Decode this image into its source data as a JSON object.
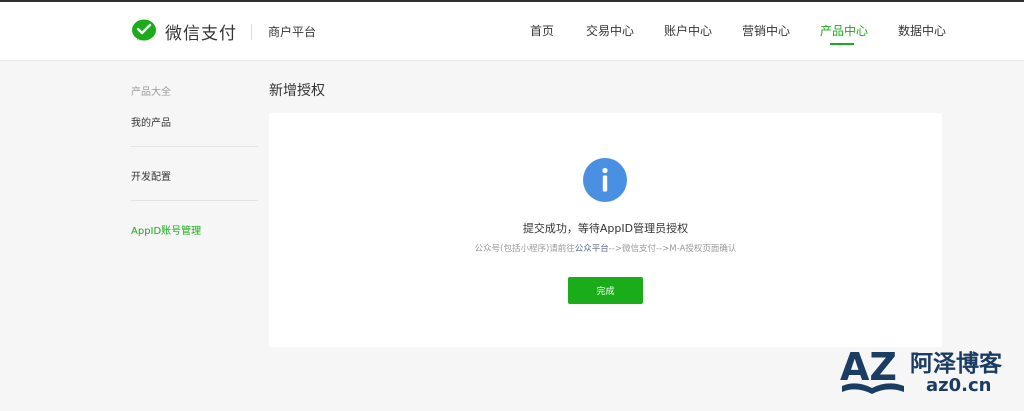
{
  "header": {
    "brand_name": "微信支付",
    "brand_sub": "商户平台",
    "nav": [
      {
        "label": "首页",
        "active": false
      },
      {
        "label": "交易中心",
        "active": false
      },
      {
        "label": "账户中心",
        "active": false
      },
      {
        "label": "营销中心",
        "active": false
      },
      {
        "label": "产品中心",
        "active": true
      },
      {
        "label": "数据中心",
        "active": false
      }
    ]
  },
  "sidebar": {
    "group_title": "产品大全",
    "items": [
      {
        "label": "我的产品",
        "active": false
      },
      {
        "label": "开发配置",
        "active": false
      },
      {
        "label": "AppID账号管理",
        "active": true
      }
    ]
  },
  "main": {
    "page_title": "新增授权",
    "message_title": "提交成功，等待AppID管理员授权",
    "message_desc_prefix": "公众号(包括小程序)请前往",
    "message_desc_link": "公众平台",
    "message_desc_suffix": "-->微信支付-->M-A授权页面确认",
    "done_label": "完成"
  },
  "watermark": {
    "logo_text": "AZ",
    "name": "阿泽博客",
    "domain": "az0.cn"
  },
  "colors": {
    "accent": "#1aad19",
    "info_blue": "#4a90e2",
    "link": "#576b95",
    "watermark": "#1b3d63"
  },
  "icons": [
    "wechat-pay-logo-icon",
    "info-icon",
    "az-logo-icon"
  ]
}
